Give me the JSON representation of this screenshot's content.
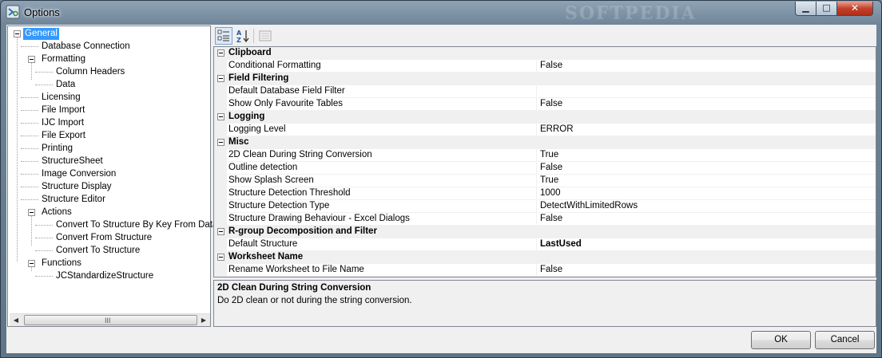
{
  "window": {
    "title": "Options",
    "watermark": "SOFTPEDIA",
    "controls": {
      "minimize": "▁",
      "maximize": "□",
      "close": "✕"
    }
  },
  "tree": {
    "items": [
      {
        "label": "General",
        "selected": true,
        "expandable": true
      },
      {
        "label": "Database Connection"
      },
      {
        "label": "Formatting",
        "expandable": true
      },
      {
        "label": "Column Headers"
      },
      {
        "label": "Data"
      },
      {
        "label": "Licensing"
      },
      {
        "label": "File Import"
      },
      {
        "label": "IJC Import"
      },
      {
        "label": "File Export"
      },
      {
        "label": "Printing"
      },
      {
        "label": "StructureSheet"
      },
      {
        "label": "Image Conversion"
      },
      {
        "label": "Structure Display"
      },
      {
        "label": "Structure Editor"
      },
      {
        "label": "Actions",
        "expandable": true
      },
      {
        "label": "Convert To Structure By Key From Datab"
      },
      {
        "label": "Convert From Structure"
      },
      {
        "label": "Convert To Structure"
      },
      {
        "label": "Functions",
        "expandable": true
      },
      {
        "label": "JCStandardizeStructure"
      }
    ],
    "scroll_grip": "III"
  },
  "toolbar": {
    "categorized_icon": "categorized-icon",
    "alphabetical_icon": "sort-az-icon",
    "property_pages_icon": "property-pages-icon"
  },
  "grid": {
    "categories": [
      {
        "name": "Clipboard",
        "props": [
          {
            "name": "Conditional Formatting",
            "value": "False"
          }
        ]
      },
      {
        "name": "Field Filtering",
        "props": [
          {
            "name": "Default Database Field Filter",
            "value": ""
          },
          {
            "name": "Show Only Favourite Tables",
            "value": "False"
          }
        ]
      },
      {
        "name": "Logging",
        "props": [
          {
            "name": "Logging Level",
            "value": "ERROR"
          }
        ]
      },
      {
        "name": "Misc",
        "props": [
          {
            "name": "2D Clean During String Conversion",
            "value": "True"
          },
          {
            "name": "Outline detection",
            "value": "False"
          },
          {
            "name": "Show Splash Screen",
            "value": "True"
          },
          {
            "name": "Structure Detection Threshold",
            "value": "1000"
          },
          {
            "name": "Structure Detection Type",
            "value": "DetectWithLimitedRows"
          },
          {
            "name": "Structure Drawing Behaviour - Excel Dialogs",
            "value": "False"
          }
        ]
      },
      {
        "name": "R-group Decomposition and Filter",
        "props": [
          {
            "name": "Default Structure",
            "value": "LastUsed",
            "bold": true
          }
        ]
      },
      {
        "name": "Worksheet Name",
        "props": [
          {
            "name": "Rename Worksheet to File Name",
            "value": "False"
          }
        ]
      }
    ]
  },
  "description": {
    "title": "2D Clean During String Conversion",
    "text": "Do 2D clean or not during the string conversion."
  },
  "buttons": {
    "ok": "OK",
    "cancel": "Cancel"
  },
  "colors": {
    "selection": "#3399ff",
    "category_bg": "#f0f0f0",
    "title_bar": "#6f8598"
  }
}
